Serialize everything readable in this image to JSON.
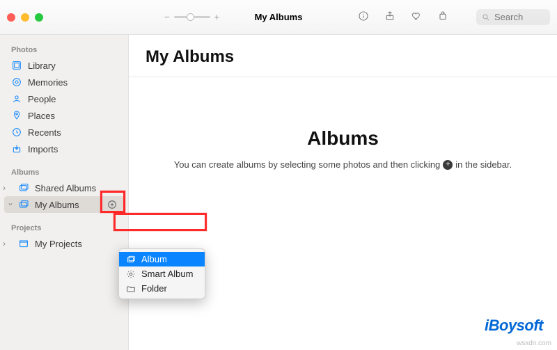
{
  "toolbar": {
    "window_title": "My Albums",
    "search_placeholder": "Search",
    "zoom_minus": "−",
    "zoom_plus": "+"
  },
  "sidebar": {
    "sections": {
      "photos_header": "Photos",
      "albums_header": "Albums",
      "projects_header": "Projects"
    },
    "photos": {
      "library": "Library",
      "memories": "Memories",
      "people": "People",
      "places": "Places",
      "recents": "Recents",
      "imports": "Imports"
    },
    "albums": {
      "shared": "Shared Albums",
      "my_albums": "My Albums"
    },
    "projects": {
      "my_projects": "My Projects"
    }
  },
  "content": {
    "heading": "My Albums",
    "empty_title": "Albums",
    "empty_hint_pre": "You can create albums by selecting some photos and then clicking",
    "empty_hint_post": "in the sidebar.",
    "plus_glyph": "+"
  },
  "context_menu": {
    "album": "Album",
    "smart_album": "Smart Album",
    "folder": "Folder"
  },
  "footer": {
    "brand": "iBoysoft",
    "watermark": "wsxdn.com"
  }
}
